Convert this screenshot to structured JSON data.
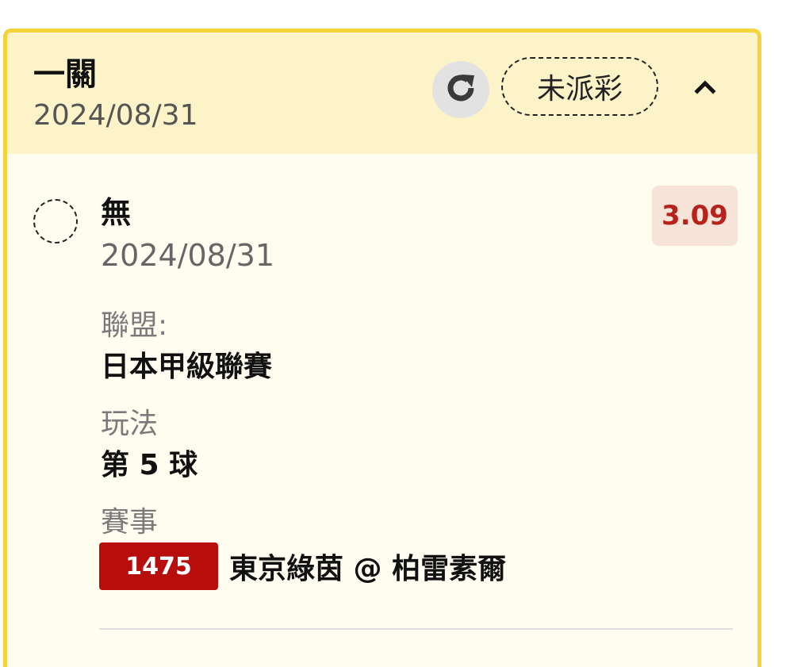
{
  "header": {
    "bet_type": "一關",
    "date": "2024/08/31",
    "status": "未派彩"
  },
  "icons": {
    "refresh": "refresh-icon",
    "collapse": "chevron-up-icon",
    "selection": "dashed-circle-icon"
  },
  "selection": {
    "name": "無",
    "date": "2024/08/31",
    "odds": "3.09"
  },
  "details": {
    "league_label": "聯盟:",
    "league_value": "日本甲級聯賽",
    "play_label": "玩法",
    "play_value": "第 5 球",
    "event_label": "賽事",
    "match_id": "1475",
    "match_name": "東京綠茵 @ 柏雷素爾"
  },
  "colors": {
    "card_border": "#f5d33a",
    "header_bg": "#fdf3c8",
    "body_bg": "#fffcf0",
    "odds_text": "#b8221c",
    "odds_bg": "#f6e4d8",
    "match_id_bg": "#b80d0d"
  }
}
